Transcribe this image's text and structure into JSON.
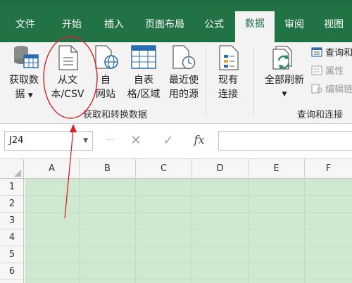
{
  "tabs": [
    {
      "label": "文件"
    },
    {
      "label": "开始"
    },
    {
      "label": "插入"
    },
    {
      "label": "页面布局"
    },
    {
      "label": "公式"
    },
    {
      "label": "数据",
      "active": true
    },
    {
      "label": "审阅"
    },
    {
      "label": "视图"
    }
  ],
  "ribbon": {
    "get_data": {
      "line1": "获取数",
      "line2": "据"
    },
    "from_text": {
      "line1": "从文",
      "line2": "本/CSV"
    },
    "from_web": {
      "line1": "自",
      "line2": "网站"
    },
    "from_table": {
      "line1": "自表",
      "line2": "格/区域"
    },
    "recent_sources": {
      "line1": "最近使",
      "line2": "用的源"
    },
    "existing_conn": {
      "line1": "现有",
      "line2": "连接"
    },
    "refresh_all": {
      "label": "全部刷新"
    },
    "queries": {
      "label": "查询和"
    },
    "properties": {
      "label": "属性"
    },
    "edit_links": {
      "label": "编辑链"
    },
    "group_get_transform": "获取和转换数据",
    "group_queries_conn": "查询和连接"
  },
  "formula_bar": {
    "name_box": "J24",
    "fx_label": "fx",
    "formula": ""
  },
  "grid": {
    "columns": [
      "A",
      "B",
      "C",
      "D",
      "E",
      "F"
    ],
    "rows": [
      "1",
      "2",
      "3",
      "4",
      "5",
      "6"
    ]
  },
  "colors": {
    "ribbon_green": "#217346",
    "cell_fill": "#cfe8cf",
    "annotation_red": "#d8232a"
  },
  "icons": [
    "database-table-icon",
    "text-file-icon",
    "web-page-icon",
    "table-range-icon",
    "clock-file-icon",
    "connection-file-icon",
    "refresh-icon",
    "queries-icon",
    "properties-icon",
    "edit-links-icon"
  ]
}
